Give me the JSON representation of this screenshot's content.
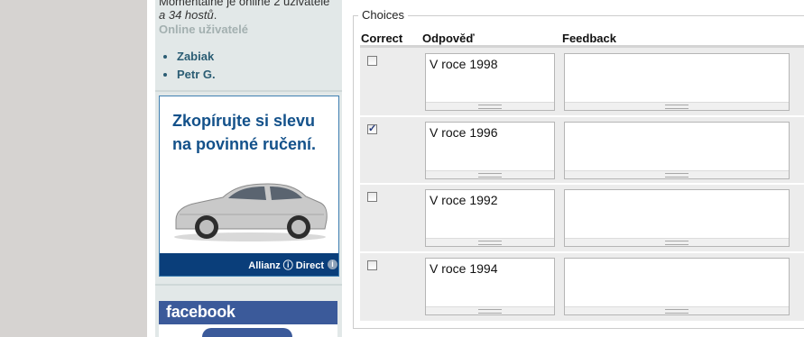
{
  "sidebar": {
    "online_line1": "Momentálně je online 2 uživatelé",
    "online_line2_em": "a 34 hostů",
    "online_line2_tail": ".",
    "online_users_heading": "Online uživatelé",
    "users": [
      "Zabiak",
      "Petr G."
    ],
    "ad": {
      "headline": "Zkopírujte si slevu na povinné ručení.",
      "brand": "Allianz ⓘ Direct",
      "info": "i"
    },
    "facebook_label": "facebook"
  },
  "choices": {
    "legend": "Choices",
    "headers": {
      "correct": "Correct",
      "answer": "Odpověď",
      "feedback": "Feedback"
    },
    "rows": [
      {
        "answer": "V roce 1998",
        "feedback": "",
        "correct": false
      },
      {
        "answer": "V roce 1996",
        "feedback": "",
        "correct": true
      },
      {
        "answer": "V roce 1992",
        "feedback": "",
        "correct": false
      },
      {
        "answer": "V roce 1994",
        "feedback": "",
        "correct": false
      }
    ]
  },
  "colors": {
    "page_background": "#d6d3d1",
    "sidebar_background": "#e2e8e8",
    "user_link": "#2b5d74",
    "ad_blue": "#13518a",
    "facebook_blue": "#3b5a9a"
  }
}
